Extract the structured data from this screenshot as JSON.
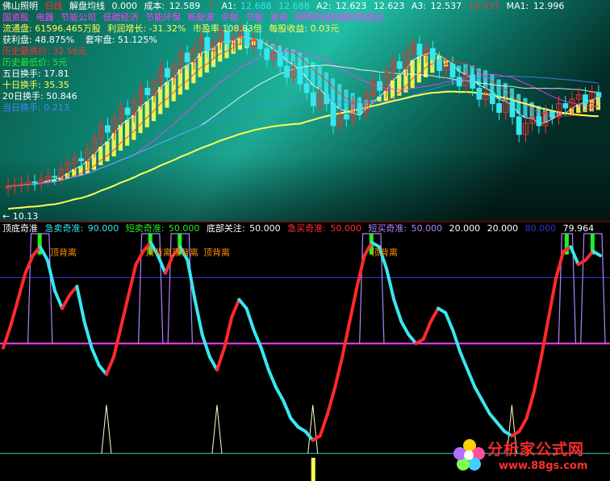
{
  "colors": {
    "bg": "#000000",
    "up": "#ff2a2a",
    "down": "#39e6f0",
    "gold": "#ffff55",
    "purple": "#b084ff",
    "magenta": "#ff3cff",
    "green": "#22ee22",
    "blue": "#3333cc",
    "orange": "#ff8c00",
    "cream": "#ffffcc"
  },
  "header": {
    "stock": "佛山照明",
    "period": "日线",
    "indicator": "解盘均线",
    "v0": "0.000",
    "cost_label": "成本:",
    "cost": "12.589",
    "a1_label": "A1:",
    "a1": "12.688",
    "a1b": "12.688",
    "a2_label": "A2:",
    "a2": "12.623",
    "a2b": "12.623",
    "a3_label": "A3:",
    "a3": "12.537",
    "a3b": "12.537",
    "ma1_label": "MA1:",
    "ma1": "12.996"
  },
  "concepts": [
    "国资股",
    "电器",
    "节能公司",
    "低碳经济",
    "节能环保",
    "新能源",
    "中航",
    "节能",
    "家电",
    "照明机械及器材制造业"
  ],
  "info": {
    "float_label": "流通盘:",
    "float_value": "61596.465万股",
    "profit_growth_label": "利润增长:",
    "profit_growth": "-31.32%",
    "pe_label": "市盈率",
    "pe_value": "108.83倍",
    "eps_label": "每股收益:",
    "eps": "0.03元",
    "win_label": "获利盘:",
    "win": "48.875%",
    "trap_label": "套牢盘:",
    "trap": "51.125%",
    "hist_high_label": "历史最高价:",
    "hist_high": "32.56元",
    "hist_low_label": "历史最低价:",
    "hist_low": "5元",
    "t5_label": "五日换手:",
    "t5": "17.81",
    "t10_label": "十日换手:",
    "t10": "35.35",
    "t20_label": "20日换手:",
    "t20": "50.846",
    "tday_label": "当日换手:",
    "tday": "0.213"
  },
  "price_marker": "10.13",
  "lower_header": {
    "name": "顶底奇准",
    "f1_label": "急卖奇准:",
    "f1": "90.000",
    "f2_label": "短卖奇准:",
    "f2": "50.000",
    "f3_label": "底部关注:",
    "f3": "50.000",
    "f4_label": "急买奇准:",
    "f4": "50.000",
    "f5_label": "短买奇准:",
    "f5": "50.000",
    "f6": "20.000",
    "f7": "20.000",
    "f8": "80.000",
    "f9": "79.964"
  },
  "annotations": [
    "顶背离",
    "顶背离",
    "顶背离",
    "顶背离",
    "顶背离"
  ],
  "watermark": {
    "line1": "分析家公式网",
    "line2": "www.88gs.com"
  },
  "chart_data": [
    {
      "type": "candlestick",
      "title": "解盘均线",
      "ylim": [
        8.5,
        17.5
      ],
      "closes": [
        9.85,
        9.9,
        9.95,
        10.05,
        10.0,
        10.15,
        10.3,
        10.25,
        10.6,
        10.9,
        11.1,
        11.0,
        11.5,
        12.0,
        12.6,
        12.3,
        12.9,
        13.4,
        13.1,
        13.7,
        14.3,
        14.0,
        14.6,
        15.2,
        14.8,
        15.3,
        15.9,
        15.5,
        16.1,
        16.6,
        16.0,
        16.4,
        16.9,
        16.3,
        16.6,
        17.0,
        16.2,
        16.5,
        16.1,
        15.6,
        15.9,
        15.3,
        14.8,
        15.2,
        14.5,
        14.1,
        13.5,
        14.0,
        13.6,
        12.6,
        13.1,
        12.9,
        13.6,
        13.2,
        14.0,
        14.6,
        14.2,
        15.0,
        15.5,
        15.2,
        15.9,
        16.3,
        15.8,
        16.1,
        15.6,
        15.1,
        15.4,
        14.8,
        14.4,
        14.9,
        14.3,
        13.8,
        14.1,
        13.6,
        13.2,
        13.7,
        13.0,
        12.2,
        12.7,
        13.0,
        12.6,
        13.2,
        13.0,
        13.6,
        13.4,
        13.8,
        14.0,
        13.6,
        14.1,
        13.9
      ]
    },
    {
      "type": "line",
      "title": "顶底奇准",
      "ylim": [
        -10,
        100
      ],
      "series": [
        {
          "values": [
            48,
            58,
            70,
            82,
            90,
            94,
            88,
            74,
            66,
            72,
            76,
            60,
            48,
            40,
            36,
            44,
            58,
            72,
            86,
            92,
            96,
            90,
            82,
            90,
            94,
            88,
            70,
            54,
            44,
            38,
            48,
            62,
            70,
            66,
            56,
            48,
            38,
            30,
            24,
            16,
            12,
            10,
            6,
            8,
            18,
            30,
            44,
            60,
            76,
            90,
            96,
            94,
            84,
            70,
            60,
            54,
            50,
            52,
            60,
            66,
            64,
            56,
            46,
            38,
            30,
            24,
            18,
            14,
            10,
            8,
            10,
            16,
            28,
            44,
            62,
            80,
            92,
            94,
            86,
            88,
            92,
            90
          ]
        }
      ]
    }
  ]
}
